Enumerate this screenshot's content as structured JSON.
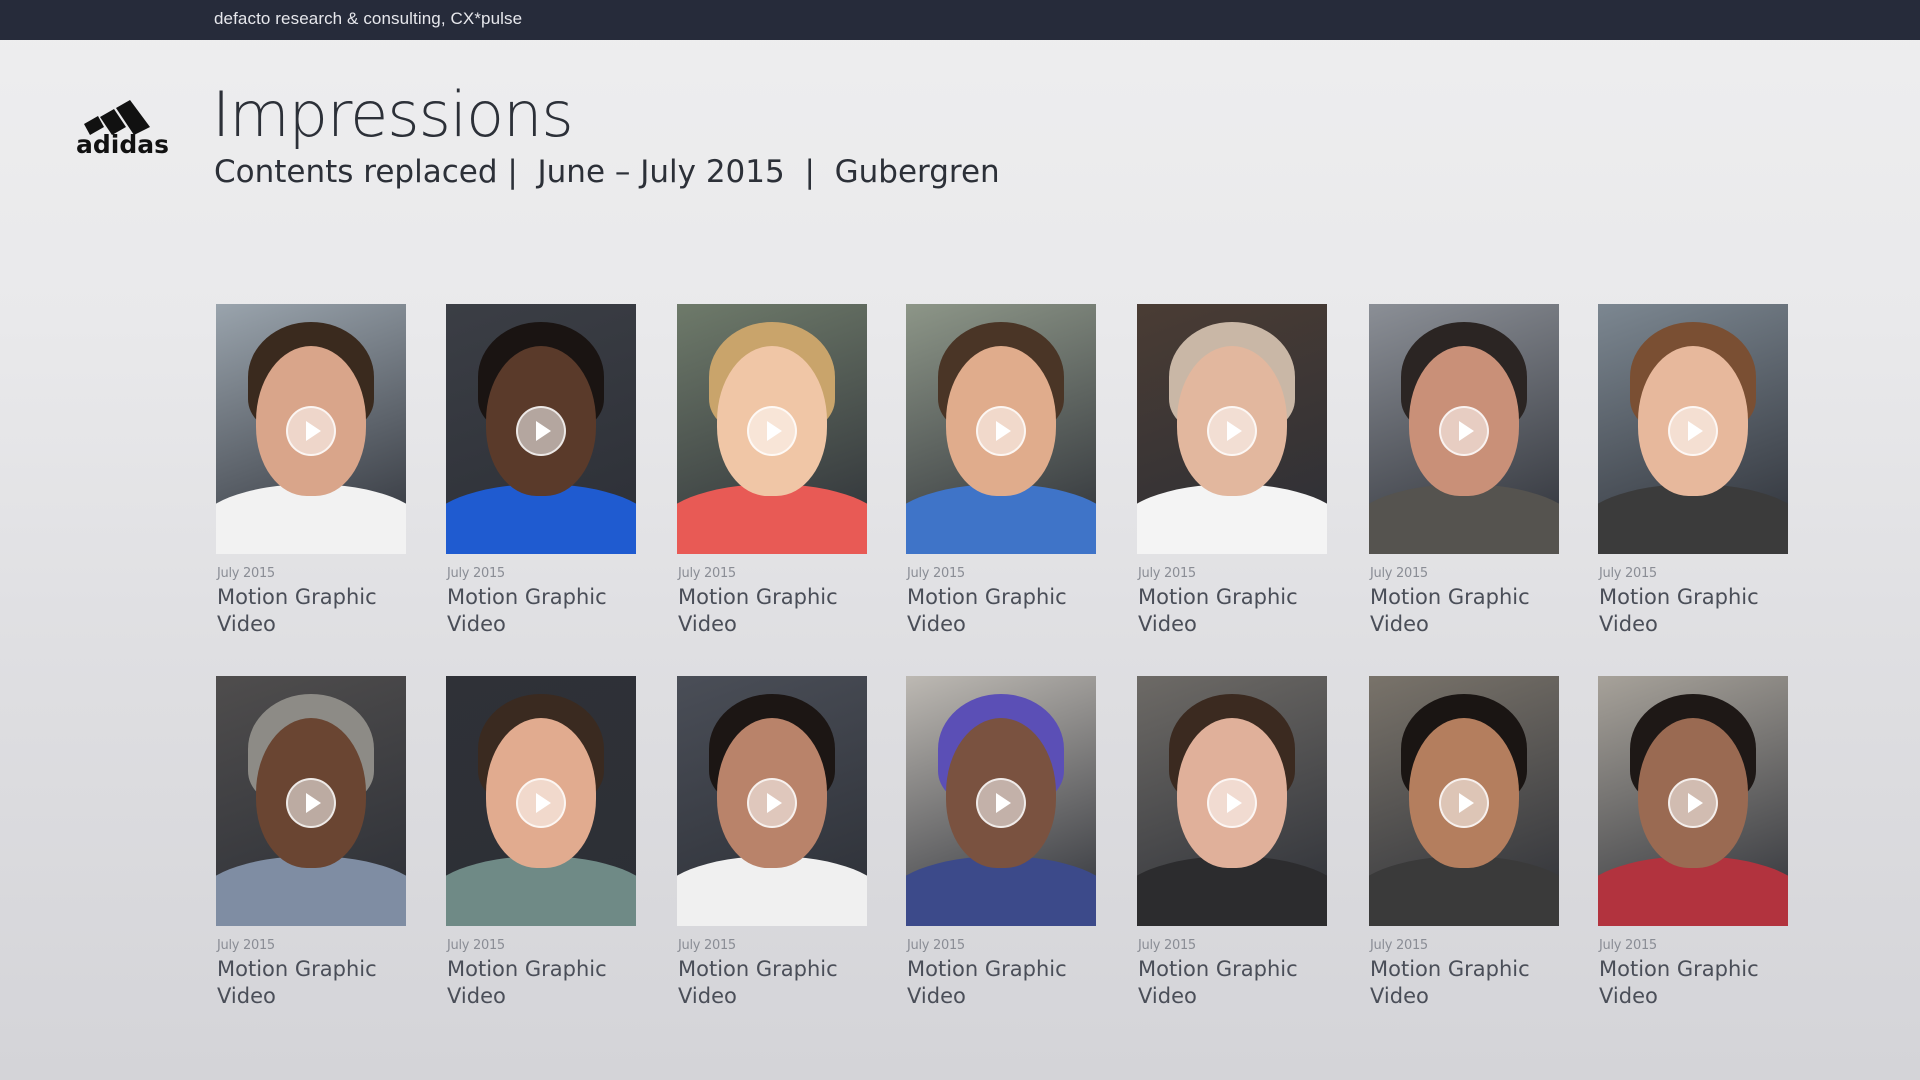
{
  "header": {
    "company": "defacto research & consulting, CX*pulse"
  },
  "brand": {
    "logo_text": "adidas"
  },
  "page": {
    "title": "Impressions",
    "subtitle": "Contents replaced |  June – July 2015  |  Gubergren"
  },
  "play_icon": "play-circle-icon",
  "cards": [
    {
      "date": "July 2015",
      "title": "Motion Graphic",
      "subtitle": "Video",
      "bg": "#9aa4ad",
      "skin": "#d9a58a",
      "hair": "#3a2a1e",
      "shirt": "#f2f2f2"
    },
    {
      "date": "July 2015",
      "title": "Motion Graphic",
      "subtitle": "Video",
      "bg": "#3b3e45",
      "skin": "#5a3a2a",
      "hair": "#1a1412",
      "shirt": "#1f5bd0"
    },
    {
      "date": "July 2015",
      "title": "Motion Graphic",
      "subtitle": "Video",
      "bg": "#6e7a6a",
      "skin": "#f0c6a6",
      "hair": "#c9a46b",
      "shirt": "#e85a55"
    },
    {
      "date": "July 2015",
      "title": "Motion Graphic",
      "subtitle": "Video",
      "bg": "#8d9688",
      "skin": "#e0ac8c",
      "hair": "#4a3526",
      "shirt": "#3f74c8"
    },
    {
      "date": "July 2015",
      "title": "Motion Graphic",
      "subtitle": "Video",
      "bg": "#4a3c34",
      "skin": "#e2b79e",
      "hair": "#c9b7a6",
      "shirt": "#f4f4f4"
    },
    {
      "date": "July 2015",
      "title": "Motion Graphic",
      "subtitle": "Video",
      "bg": "#8b8f96",
      "skin": "#c99078",
      "hair": "#2b2523",
      "shirt": "#55534f"
    },
    {
      "date": "July 2015",
      "title": "Motion Graphic",
      "subtitle": "Video",
      "bg": "#7c8791",
      "skin": "#e7b89c",
      "hair": "#7a4f33",
      "shirt": "#3b3b3b"
    },
    {
      "date": "July 2015",
      "title": "Motion Graphic",
      "subtitle": "Video",
      "bg": "#4f4d4d",
      "skin": "#6a4532",
      "hair": "#8d8b86",
      "shirt": "#7f8da3"
    },
    {
      "date": "July 2015",
      "title": "Motion Graphic",
      "subtitle": "Video",
      "bg": "#2f3137",
      "skin": "#e1ab8f",
      "hair": "#3a2a20",
      "shirt": "#6f8a86"
    },
    {
      "date": "July 2015",
      "title": "Motion Graphic",
      "subtitle": "Video",
      "bg": "#4a4e57",
      "skin": "#b9836a",
      "hair": "#1c1614",
      "shirt": "#f0f0f0"
    },
    {
      "date": "July 2015",
      "title": "Motion Graphic",
      "subtitle": "Video",
      "bg": "#bdb9b3",
      "skin": "#7a5240",
      "hair": "#5b4fb6",
      "shirt": "#3c4a8a"
    },
    {
      "date": "July 2015",
      "title": "Motion Graphic",
      "subtitle": "Video",
      "bg": "#6d6a66",
      "skin": "#e0b09a",
      "hair": "#3b2a20",
      "shirt": "#2c2c2e"
    },
    {
      "date": "July 2015",
      "title": "Motion Graphic",
      "subtitle": "Video",
      "bg": "#79736a",
      "skin": "#b47e5e",
      "hair": "#1a1513",
      "shirt": "#3a3a3a"
    },
    {
      "date": "July 2015",
      "title": "Motion Graphic",
      "subtitle": "Video",
      "bg": "#a7a29a",
      "skin": "#9a6a52",
      "hair": "#1e1816",
      "shirt": "#b2333e"
    }
  ]
}
